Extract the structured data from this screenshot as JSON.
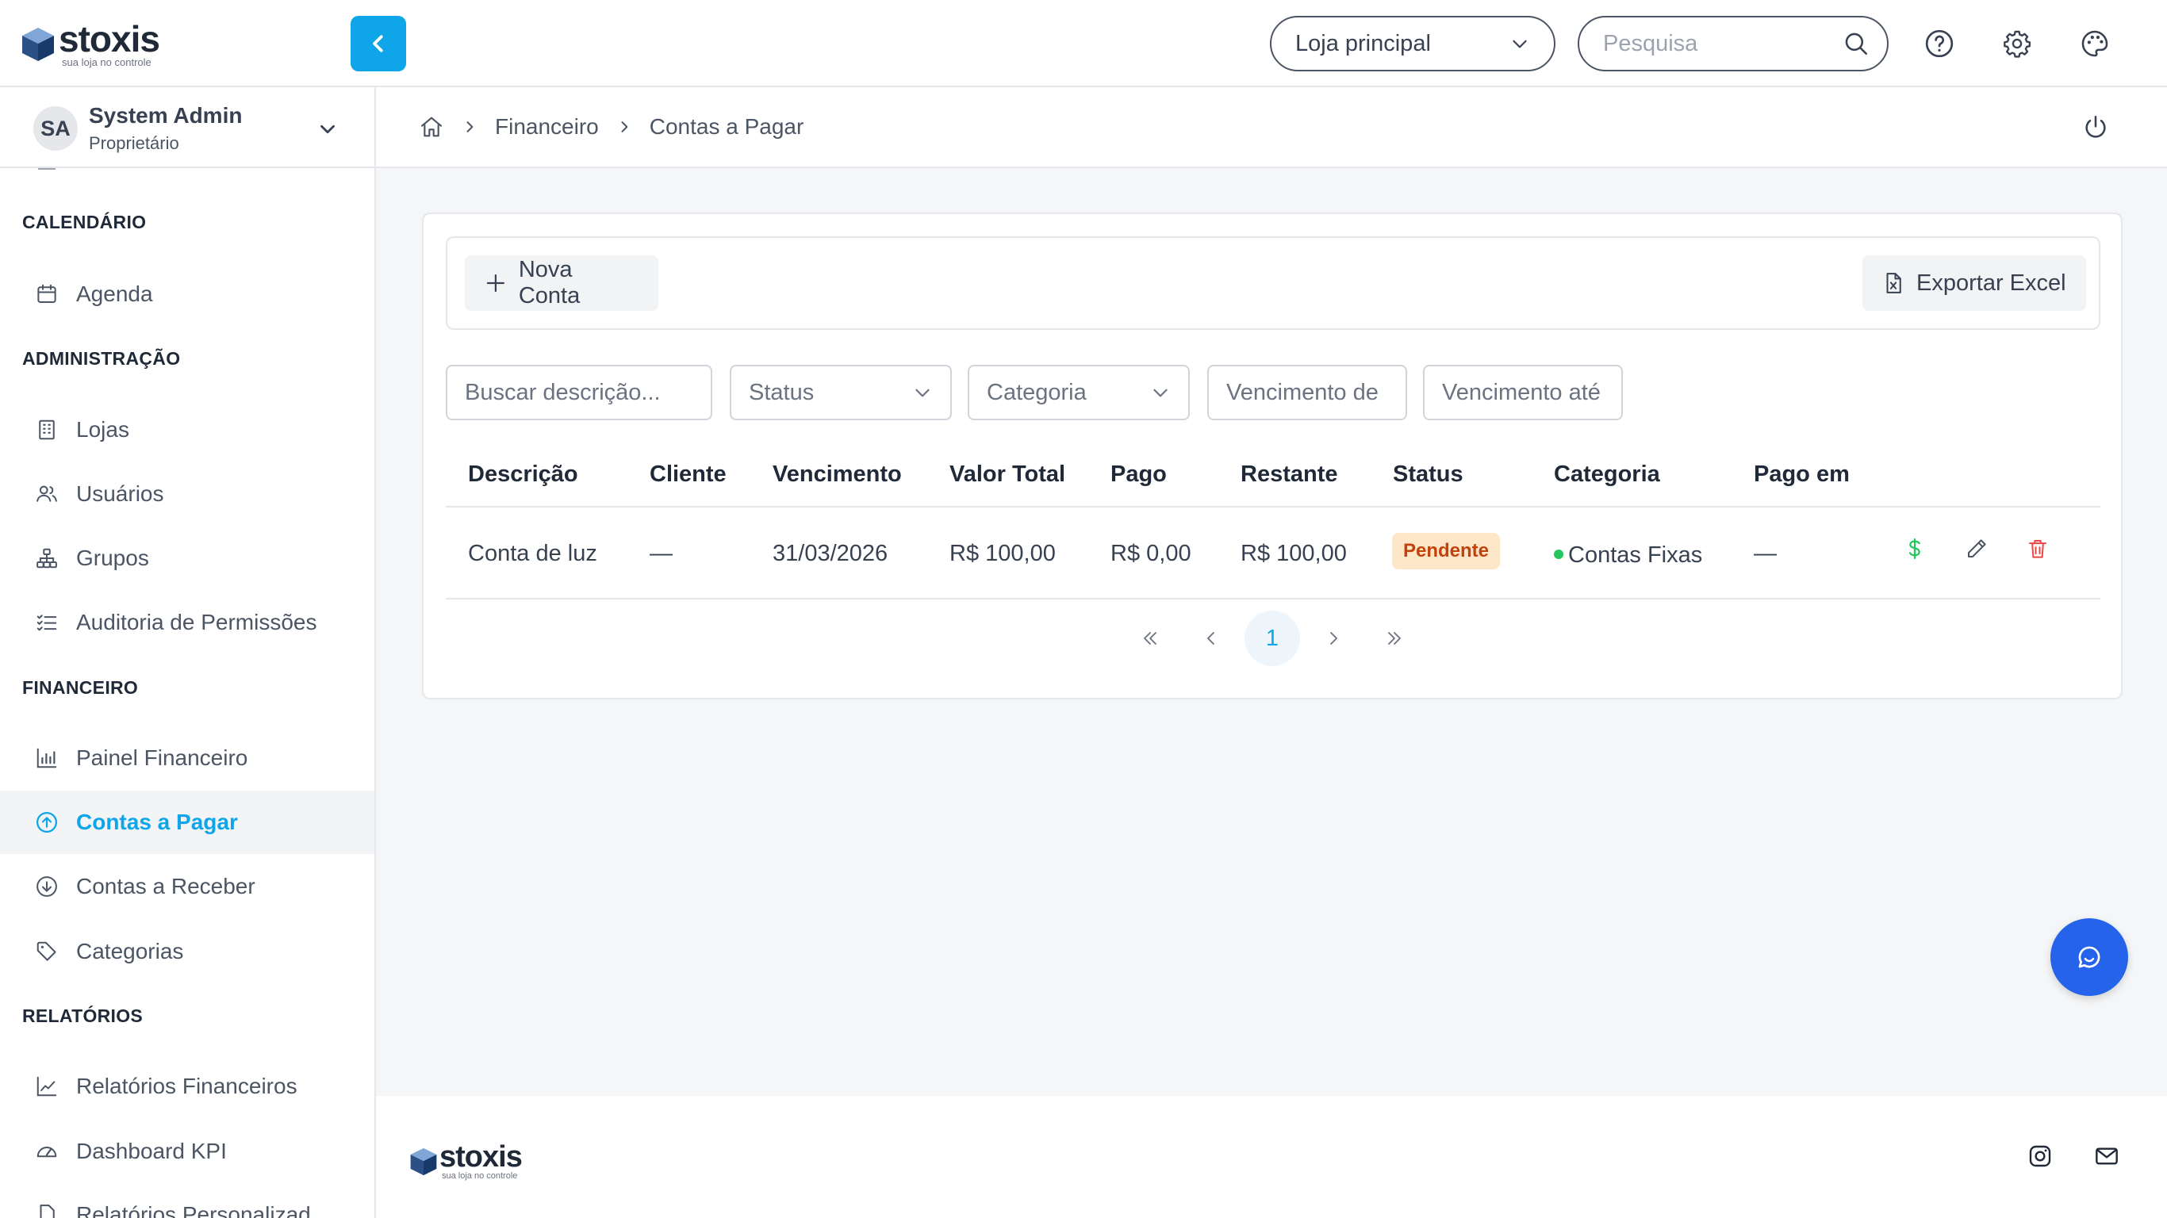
{
  "brand": {
    "name": "stoxis",
    "tagline": "sua loja no controle"
  },
  "topbar": {
    "store_select": "Loja principal",
    "search_placeholder": "Pesquisa"
  },
  "user": {
    "initials": "SA",
    "name": "System Admin",
    "role": "Proprietário"
  },
  "sidebar": {
    "sections": {
      "calendar": "CALENDÁRIO",
      "admin": "ADMINISTRAÇÃO",
      "finance": "FINANCEIRO",
      "reports": "RELATÓRIOS"
    },
    "items": {
      "agenda": "Agenda",
      "lojas": "Lojas",
      "usuarios": "Usuários",
      "grupos": "Grupos",
      "auditoria": "Auditoria de Permissões",
      "painel": "Painel Financeiro",
      "contas_pagar": "Contas a Pagar",
      "contas_receber": "Contas a Receber",
      "categorias": "Categorias",
      "relatorios_fin": "Relatórios Financeiros",
      "dashboard_kpi": "Dashboard KPI",
      "relatorios_pers": "Relatórios Personalizad"
    }
  },
  "breadcrumb": {
    "level1": "Financeiro",
    "level2": "Contas a Pagar"
  },
  "toolbar": {
    "new_label": "Nova Conta",
    "export_label": "Exportar Excel"
  },
  "filters": {
    "search_placeholder": "Buscar descrição...",
    "status": "Status",
    "category": "Categoria",
    "due_from_placeholder": "Vencimento de",
    "due_to_placeholder": "Vencimento até"
  },
  "table": {
    "headers": {
      "descricao": "Descrição",
      "cliente": "Cliente",
      "vencimento": "Vencimento",
      "valor_total": "Valor Total",
      "pago": "Pago",
      "restante": "Restante",
      "status": "Status",
      "categoria": "Categoria",
      "pago_em": "Pago em"
    },
    "rows": [
      {
        "descricao": "Conta de luz",
        "cliente": "—",
        "vencimento": "31/03/2026",
        "valor_total": "R$ 100,00",
        "pago": "R$ 0,00",
        "restante": "R$ 100,00",
        "status": "Pendente",
        "categoria": "Contas Fixas",
        "pago_em": "—"
      }
    ]
  },
  "pagination": {
    "current": "1"
  },
  "colors": {
    "accent": "#0ea5e9",
    "fab": "#2563eb",
    "status_pending_bg": "#fde7c8",
    "status_pending_text": "#c2410c",
    "category_dot": "#22c55e",
    "pay_icon": "#22c55e",
    "delete_icon": "#ef4444"
  },
  "icons": {
    "collapse": "chevron-left-icon",
    "help": "help-circle-icon",
    "settings": "gear-icon",
    "theme": "palette-icon",
    "logout": "power-icon",
    "chat": "chat-icon"
  }
}
